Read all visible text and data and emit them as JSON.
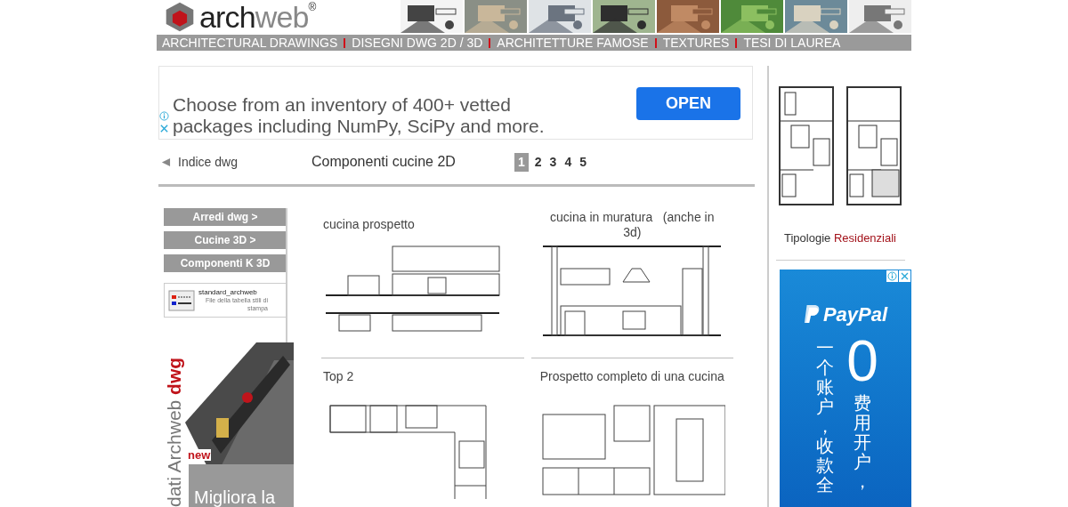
{
  "header": {
    "logo": {
      "part1": "arch",
      "part2": "web",
      "mark": "®"
    }
  },
  "nav": [
    "ARCHITECTURAL DRAWINGS",
    "DISEGNI DWG 2D / 3D",
    "ARCHITETTURE FAMOSE",
    "TEXTURES",
    "TESI DI LAUREA"
  ],
  "ad": {
    "lines": [
      "Choose from an inventory of 400+ vetted",
      "packages including NumPy, SciPy and more."
    ],
    "button": "OPEN"
  },
  "breadcrumb": {
    "back": "Indice dwg",
    "title": "Componenti cucine 2D",
    "pages": [
      {
        "label": "1",
        "selected": true
      },
      {
        "label": "2",
        "selected": false
      },
      {
        "label": "3",
        "selected": false
      },
      {
        "label": "4",
        "selected": false
      },
      {
        "label": "5",
        "selected": false
      }
    ]
  },
  "sidebar": {
    "buttons": [
      "Arredi dwg >",
      "Cucine 3D >",
      "Componenti K 3D"
    ],
    "file": {
      "name": "standard_archweb",
      "description": "File della tabella stili di stampa"
    },
    "promo": {
      "vertical": "dati Archweb",
      "vertical_accent": "dwg",
      "badge": "new",
      "caption": "Migliora la"
    }
  },
  "items": [
    {
      "title": "cucina prospetto",
      "kind": "elevation"
    },
    {
      "title": "cucina in muratura   (anche in 3d)",
      "kind": "masonry"
    },
    {
      "title": "Top 2",
      "kind": "plan"
    },
    {
      "title": "Prospetto completo di una cucina",
      "kind": "full"
    }
  ],
  "right": {
    "caption": "Tipologie",
    "caption_accent": "Residenziali",
    "paypal_ad": {
      "brand": "PayPal",
      "big": "0",
      "column_1": "一个账户，收款全",
      "column_2": "费用开户，"
    }
  }
}
